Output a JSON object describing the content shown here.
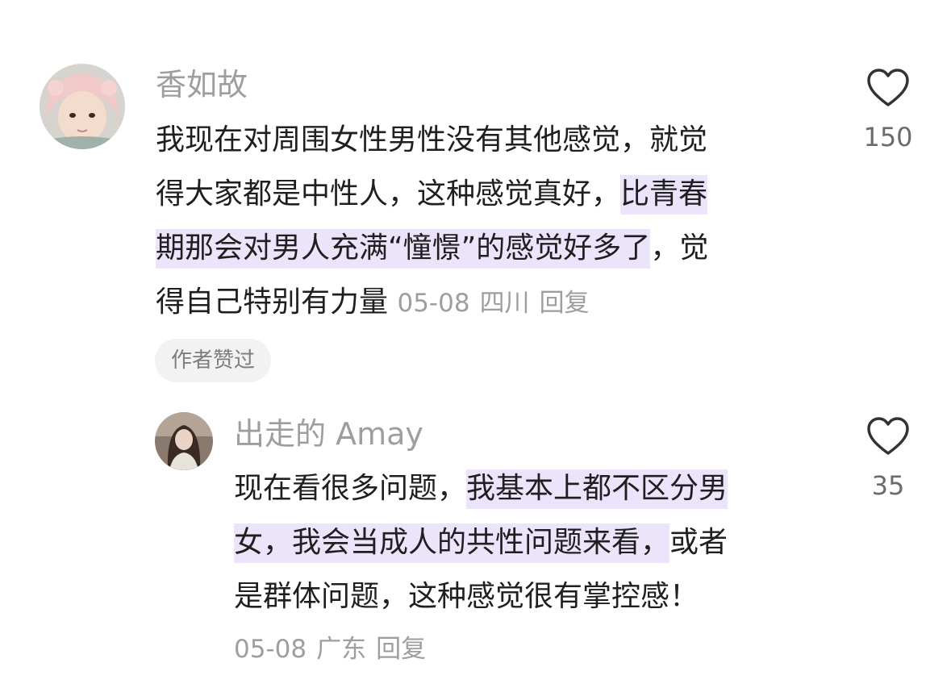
{
  "comments": [
    {
      "username": "香如故",
      "avatar": "baby-in-pink-hood-avatar",
      "lines": [
        [
          {
            "text": "我现在对周围女性男性没有其他感觉，就觉",
            "highlight": false
          }
        ],
        [
          {
            "text": "得大家都是中性人，这种感觉真好，",
            "highlight": false
          },
          {
            "text": "比青春",
            "highlight": true
          }
        ],
        [
          {
            "text": "期那会对男人充满“憧憬”的感觉好多了",
            "highlight": true
          },
          {
            "text": "，觉",
            "highlight": false
          }
        ],
        [
          {
            "text": "得自己特别有力量",
            "highlight": false
          }
        ]
      ],
      "date": "05-08",
      "location": "四川",
      "reply_label": "回复",
      "badge": "作者赞过",
      "like_count": "150"
    },
    {
      "username": "出走的 Amay",
      "avatar": "woman-portrait-avatar",
      "lines": [
        [
          {
            "text": "现在看很多问题，",
            "highlight": false
          },
          {
            "text": "我基本上都不区分男",
            "highlight": true
          }
        ],
        [
          {
            "text": "女，我会当成人的共性问题来看，",
            "highlight": true
          },
          {
            "text": "或者",
            "highlight": false
          }
        ],
        [
          {
            "text": "是群体问题，这种感觉很有掌控感！",
            "highlight": false
          }
        ]
      ],
      "date": "05-08",
      "location": "广东",
      "reply_label": "回复",
      "like_count": "35"
    }
  ],
  "colors": {
    "highlight": "#ece4fb",
    "muted_text": "#9e9e9e",
    "body_text": "#1f1f1f",
    "badge_background": "#f2f2f2"
  },
  "icons": {
    "like": "heart-outline-icon"
  }
}
